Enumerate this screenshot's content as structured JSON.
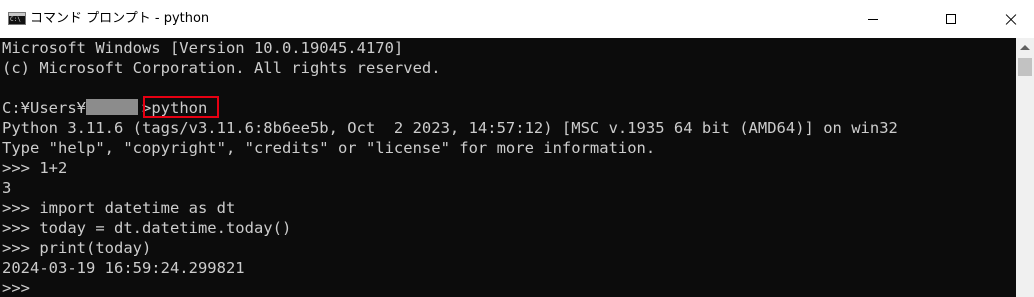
{
  "window": {
    "title": "コマンド プロンプト - python",
    "icon": "cmd-icon",
    "controls": [
      "minimize-icon",
      "maximize-icon",
      "close-icon"
    ]
  },
  "console": {
    "lines": [
      "Microsoft Windows [Version 10.0.19045.4170]",
      "(c) Microsoft Corporation. All rights reserved.",
      "",
      "C:¥Users¥",
      "Python 3.11.6 (tags/v3.11.6:8b6ee5b, Oct  2 2023, 14:57:12) [MSC v.1935 64 bit (AMD64)] on win32",
      "Type \"help\", \"copyright\", \"credits\" or \"license\" for more information.",
      ">>> 1+2",
      "3",
      ">>> import datetime as dt",
      ">>> today = dt.datetime.today()",
      ">>> print(today)",
      "2024-03-19 16:59:24.299821",
      ">>>"
    ],
    "prompt_suffix": ">",
    "command": "python",
    "highlight_color": "#e60012"
  },
  "colors": {
    "console_bg": "#0c0c0c",
    "console_text": "#cccccc",
    "titlebar_bg": "#ffffff"
  }
}
